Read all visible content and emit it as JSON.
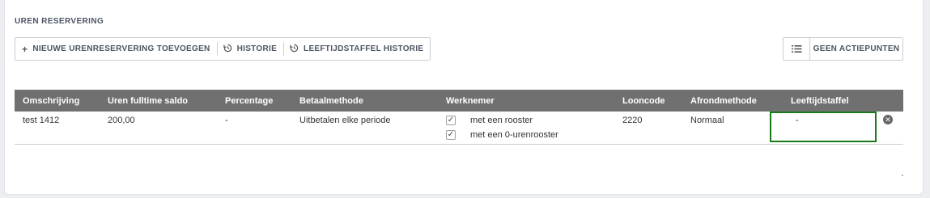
{
  "section": {
    "title": "UREN RESERVERING"
  },
  "toolbar": {
    "add_label": "NIEUWE URENRESERVERING TOEVOEGEN",
    "history_label": "HISTORIE",
    "age_history_label": "LEEFTIJDSTAFFEL HISTORIE",
    "icons": {
      "add": "plus-icon",
      "history": "history-icon",
      "age_history": "history-icon"
    }
  },
  "actions": {
    "label": "GEEN ACTIEPUNTEN",
    "icon": "list-icon"
  },
  "table": {
    "headers": {
      "omschrijving": "Omschrijving",
      "uren": "Uren fulltime saldo",
      "percentage": "Percentage",
      "betaalmethode": "Betaalmethode",
      "werknemer": "Werknemer",
      "looncode": "Looncode",
      "afrondmethode": "Afrondmethode",
      "leeftijdstaffel": "Leeftijdstaffel"
    },
    "rows": [
      {
        "omschrijving": "test 1412",
        "uren": "200,00",
        "percentage": "-",
        "betaalmethode": "Uitbetalen elke periode",
        "werknemer_1": "met een rooster",
        "werknemer_2": "met een 0-urenrooster",
        "looncode": "2220",
        "afrondmethode": "Normaal",
        "leeftijdstaffel": "-"
      }
    ]
  },
  "colors": {
    "header_bg": "#707070",
    "highlight": "#1a7a1a"
  }
}
